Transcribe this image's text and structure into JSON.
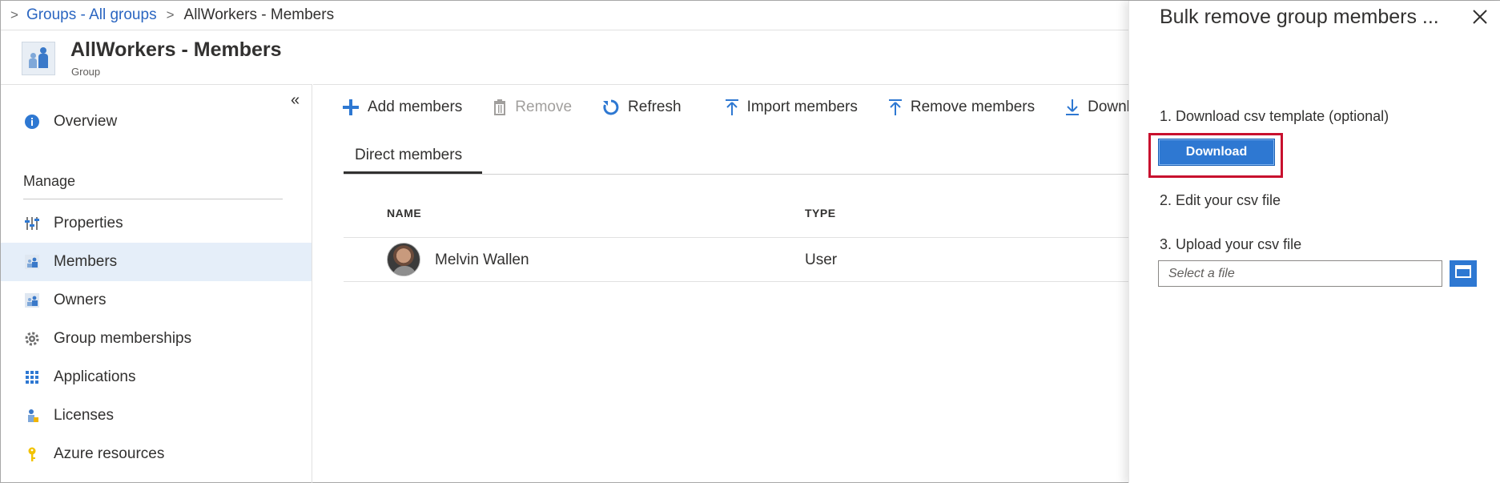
{
  "breadcrumb": {
    "items": [
      "Groups - All groups",
      "AllWorkers - Members"
    ]
  },
  "header": {
    "title": "AllWorkers - Members",
    "subtitle": "Group",
    "icon": "group-icon"
  },
  "sidebar": {
    "collapse_label": "«",
    "overview": {
      "label": "Overview",
      "icon": "info-icon"
    },
    "section_label": "Manage",
    "items": [
      {
        "label": "Properties",
        "icon": "properties-icon",
        "selected": false
      },
      {
        "label": "Members",
        "icon": "members-icon",
        "selected": true
      },
      {
        "label": "Owners",
        "icon": "owners-icon",
        "selected": false
      },
      {
        "label": "Group memberships",
        "icon": "gear-icon",
        "selected": false
      },
      {
        "label": "Applications",
        "icon": "applications-grid-icon",
        "selected": false
      },
      {
        "label": "Licenses",
        "icon": "licenses-icon",
        "selected": false
      },
      {
        "label": "Azure resources",
        "icon": "key-icon",
        "selected": false
      }
    ]
  },
  "toolbar": {
    "add_members": "Add members",
    "remove": "Remove",
    "refresh": "Refresh",
    "import_members": "Import members",
    "remove_members": "Remove members",
    "download": "Downlo"
  },
  "tabs": {
    "direct_members": "Direct members"
  },
  "table": {
    "columns": [
      "NAME",
      "TYPE"
    ],
    "rows": [
      {
        "name": "Melvin Wallen",
        "type": "User"
      }
    ]
  },
  "panel": {
    "title": "Bulk remove group members ...",
    "step1": "1. Download csv template (optional)",
    "download_button": "Download",
    "step2": "2. Edit your csv file",
    "step3": "3. Upload your csv file",
    "file_placeholder": "Select a file"
  },
  "colors": {
    "accent": "#2e78d2",
    "link": "#2b66c1",
    "highlight": "#c8102e",
    "selected_bg": "#e5eef9"
  }
}
